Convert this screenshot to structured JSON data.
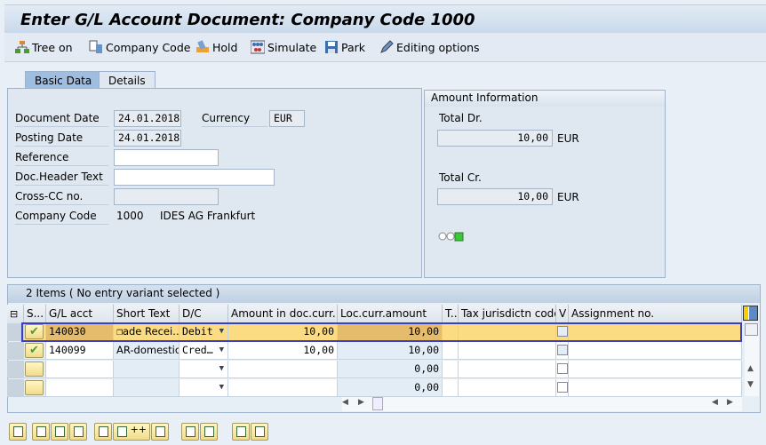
{
  "title": "Enter G/L Account Document: Company Code 1000",
  "toolbar": [
    {
      "label": "Tree on",
      "icon": "tree-icon"
    },
    {
      "label": "Company Code",
      "icon": "company-code-icon"
    },
    {
      "label": "Hold",
      "icon": "hold-icon"
    },
    {
      "label": "Simulate",
      "icon": "simulate-icon"
    },
    {
      "label": "Park",
      "icon": "save-icon"
    },
    {
      "label": "Editing options",
      "icon": "pencil-icon"
    }
  ],
  "tabs": [
    {
      "label": "Basic Data",
      "active": true
    },
    {
      "label": "Details",
      "active": false
    }
  ],
  "basic": {
    "document_date_label": "Document Date",
    "document_date": "24.01.2018",
    "currency_label": "Currency",
    "currency": "EUR",
    "posting_date_label": "Posting Date",
    "posting_date": "24.01.2018",
    "reference_label": "Reference",
    "reference": "",
    "header_text_label": "Doc.Header Text",
    "header_text": "",
    "cross_cc_label": "Cross-CC no.",
    "cross_cc": "",
    "company_code_label": "Company Code",
    "company_code": "1000",
    "company_name": "IDES AG Frankfurt"
  },
  "amount_info": {
    "title": "Amount Information",
    "total_dr_label": "Total Dr.",
    "total_dr": "10,00",
    "total_dr_cur": "EUR",
    "total_cr_label": "Total Cr.",
    "total_cr": "10,00",
    "total_cr_cur": "EUR",
    "status_light": "green"
  },
  "grid": {
    "title": "2 Items ( No entry variant selected )",
    "columns": [
      "S...",
      "G/L acct",
      "Short Text",
      "D/C",
      "Amount in doc.curr.",
      "Loc.curr.amount",
      "T..",
      "Tax jurisdictn code",
      "V",
      "Assignment no."
    ],
    "rows": [
      {
        "status": "ok",
        "gl": "140030",
        "short": "ade Recei…",
        "dc": "Debit",
        "amt": "10,00",
        "loc": "10,00",
        "selected": true
      },
      {
        "status": "ok",
        "gl": "140099",
        "short": "AR-domestic…",
        "dc": "Cred…",
        "amt": "10,00",
        "loc": "10,00",
        "selected": false
      },
      {
        "status": "",
        "gl": "",
        "short": "",
        "dc": "",
        "amt": "",
        "loc": "0,00",
        "selected": false
      },
      {
        "status": "",
        "gl": "",
        "short": "",
        "dc": "",
        "amt": "",
        "loc": "0,00",
        "selected": false
      }
    ]
  },
  "colors": {
    "selected_row": "#fbdc83",
    "selection_border": "#3a3fc4",
    "check": "#4a9c2d"
  }
}
